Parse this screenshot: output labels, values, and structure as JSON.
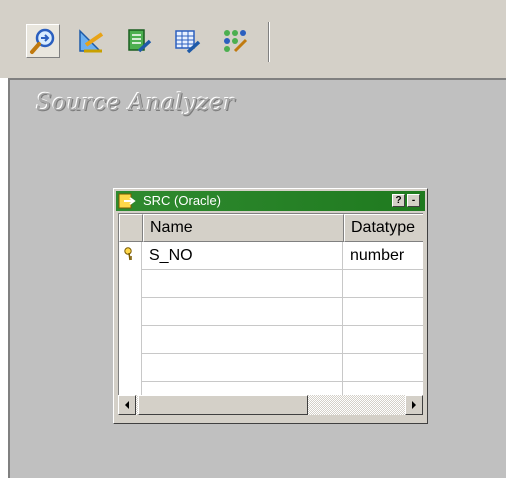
{
  "toolbar": {
    "buttons": [
      {
        "icon": "source-analyzer-icon",
        "active": true
      },
      {
        "icon": "target-designer-icon",
        "active": false
      },
      {
        "icon": "transformation-developer-icon",
        "active": false
      },
      {
        "icon": "mapplet-designer-icon",
        "active": false
      },
      {
        "icon": "mapping-designer-icon",
        "active": false
      }
    ]
  },
  "workspace": {
    "title": "Source Analyzer"
  },
  "source_window": {
    "title": "SRC (Oracle)",
    "help_button": "?",
    "minimize_button": "-",
    "columns": [
      "Name",
      "Datatype"
    ],
    "rows": [
      {
        "name": "S_NO",
        "datatype": "number",
        "key": true
      },
      {
        "name": "",
        "datatype": ""
      },
      {
        "name": "",
        "datatype": ""
      },
      {
        "name": "",
        "datatype": ""
      },
      {
        "name": "",
        "datatype": ""
      },
      {
        "name": "",
        "datatype": ""
      }
    ]
  },
  "colors": {
    "title_bar": "#2f8a2f",
    "workspace_bg": "#c0c0c0",
    "chrome_bg": "#d4d0c8"
  }
}
